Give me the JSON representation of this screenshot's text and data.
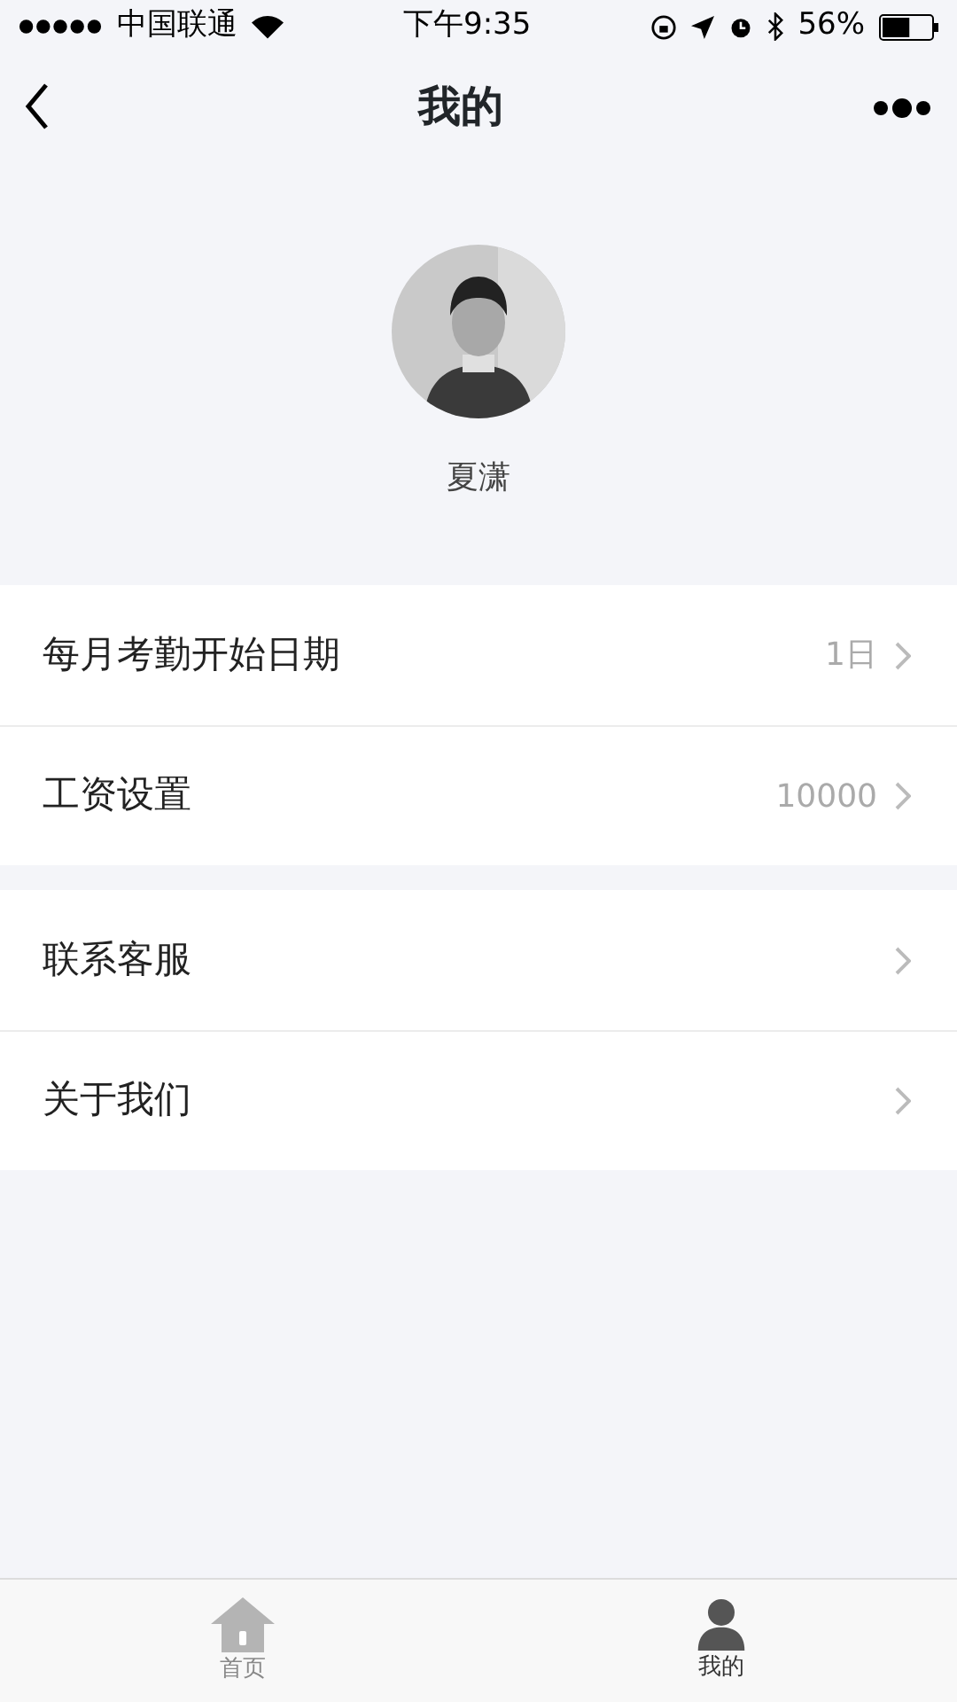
{
  "status_bar": {
    "carrier": "中国联通",
    "time": "下午9:35",
    "battery": "56%"
  },
  "nav": {
    "title": "我的"
  },
  "profile": {
    "name": "夏潇"
  },
  "groups": [
    {
      "items": [
        {
          "label": "每月考勤开始日期",
          "value": "1日"
        },
        {
          "label": "工资设置",
          "value": "10000"
        }
      ]
    },
    {
      "items": [
        {
          "label": "联系客服"
        },
        {
          "label": "关于我们"
        }
      ]
    }
  ],
  "tabbar": [
    {
      "label": "首页",
      "selected": false
    },
    {
      "label": "我的",
      "selected": true
    }
  ]
}
